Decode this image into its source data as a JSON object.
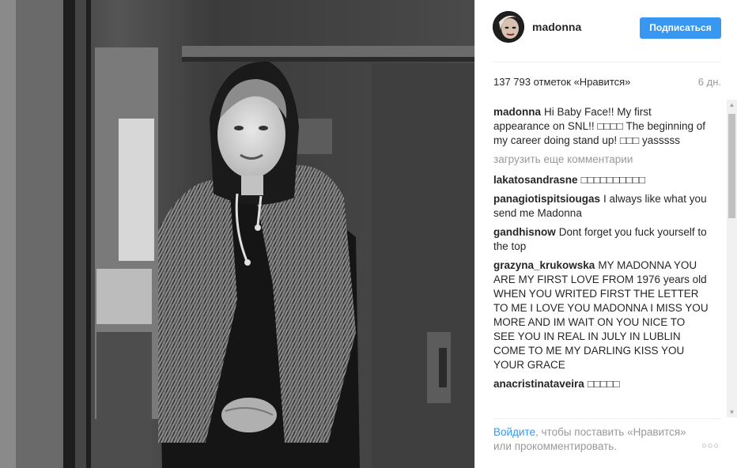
{
  "post": {
    "photo_icon": "photo-madonna-bw"
  },
  "header": {
    "username": "madonna",
    "follow_label": "Подписаться",
    "avatar_icon": "avatar-icon"
  },
  "stats": {
    "likes": "137 793 отметок «Нравится»",
    "time": "6 дн."
  },
  "caption": {
    "author": "madonna",
    "text": "Hi Baby Face!! My first appearance on SNL!! □□□□ The beginning of my career doing stand up! □□□ yasssss"
  },
  "load_more": "загрузить еще комментарии",
  "comments": [
    {
      "author": "lakatosandrasne",
      "text": "□□□□□□□□□□"
    },
    {
      "author": "panagiotispitsiougas",
      "text": "I always like what you send me Madonna"
    },
    {
      "author": "gandhisnow",
      "text": "Dont forget you fuck yourself to the top"
    },
    {
      "author": "grazyna_krukowska",
      "text": "MY MADONNA YOU ARE MY FIRST LOVE FROM 1976 years old WHEN YOU WRITED FIRST THE LETTER TO ME I LOVE YOU MADONNA I MISS YOU MORE AND IM WAIT ON YOU NICE TO SEE YOU IN REAL IN JULY IN LUBLIN COME TO ME MY DARLING KISS YOU YOUR GRACE"
    },
    {
      "author": "anacristinataveira",
      "text": "□□□□□"
    }
  ],
  "footer": {
    "login_link": "Войдите",
    "text_after_link": ", чтобы поставить «Нравится» или прокомментировать.",
    "more_options": "○○○"
  },
  "scrollbar": {
    "up": "▲",
    "down": "▼"
  },
  "colors": {
    "accent": "#3897f0",
    "text": "#262626",
    "muted": "#999999"
  }
}
